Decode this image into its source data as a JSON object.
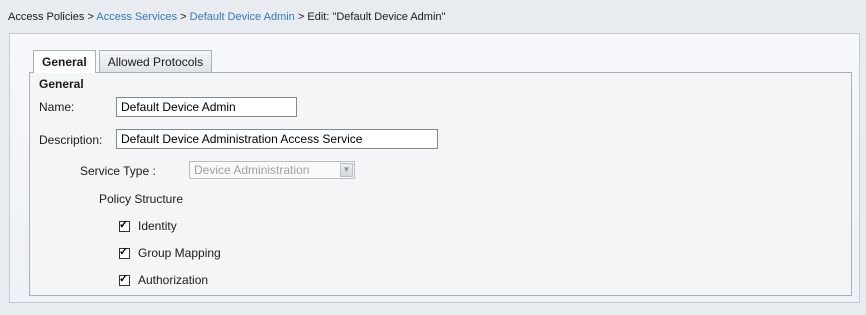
{
  "breadcrumb": {
    "root": "Access Policies",
    "sep": ">",
    "level1": "Access Services",
    "level2": "Default Device Admin",
    "current": "Edit: \"Default Device Admin\""
  },
  "tabs": [
    {
      "label": "General",
      "active": true
    },
    {
      "label": "Allowed Protocols",
      "active": false
    }
  ],
  "general": {
    "section_title": "General",
    "name_label": "Name:",
    "name_value": "Default Device Admin",
    "description_label": "Description:",
    "description_value": "Default Device Administration Access Service",
    "service_type_label": "Service Type :",
    "service_type_value": "Device Administration",
    "policy_structure_label": "Policy Structure",
    "policy_items": [
      {
        "label": "Identity",
        "checked": true
      },
      {
        "label": "Group Mapping",
        "checked": true
      },
      {
        "label": "Authorization",
        "checked": true
      }
    ]
  }
}
